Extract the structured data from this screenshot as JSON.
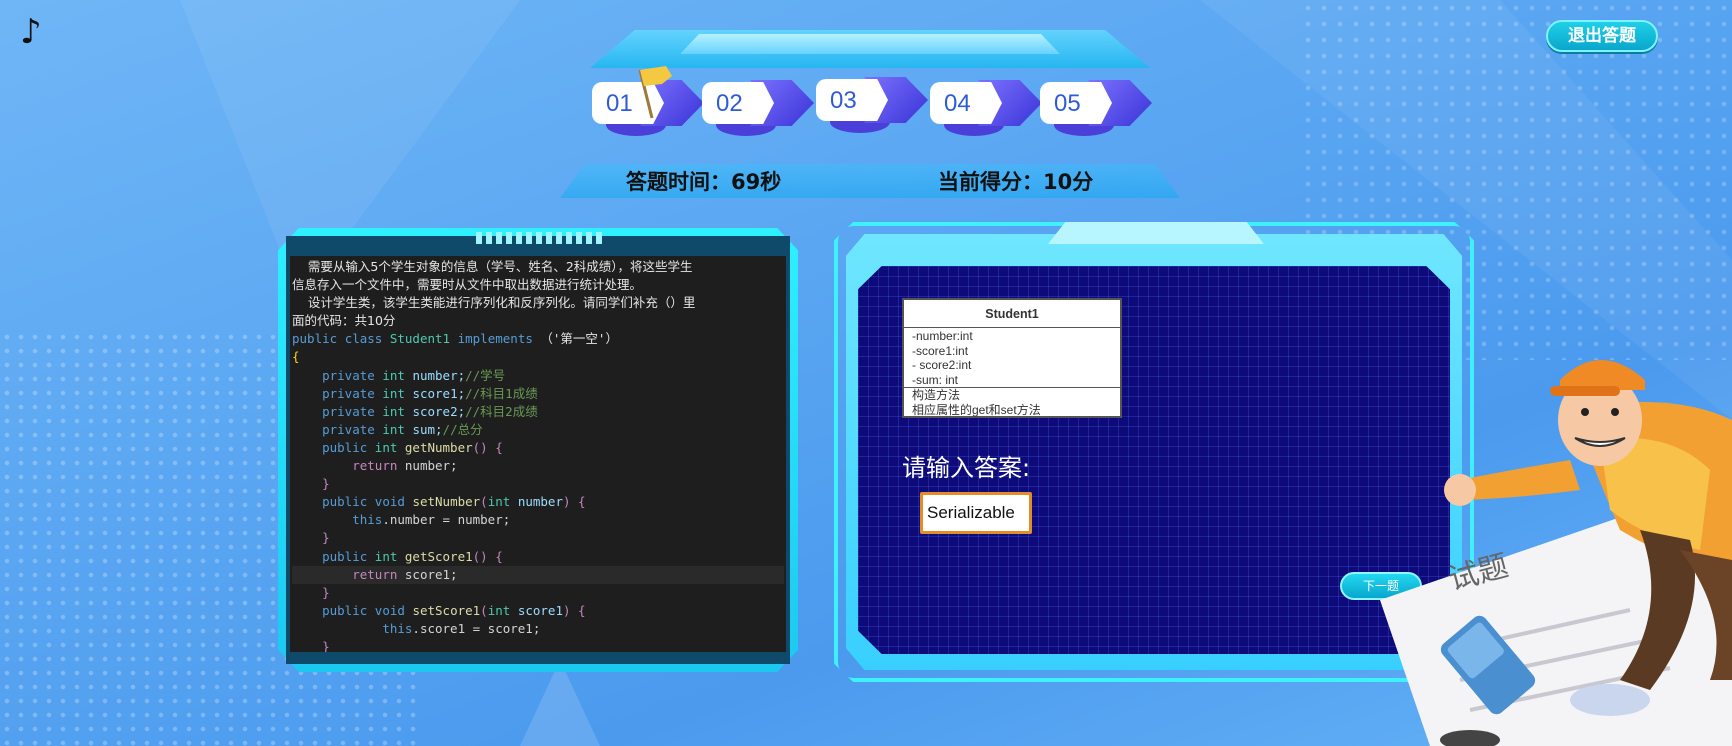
{
  "header": {
    "quit_label": "退出答题",
    "steps": [
      "01",
      "02",
      "03",
      "04",
      "05"
    ],
    "current_step": "01",
    "time_label": "答题时间：69秒",
    "score_label": "当前得分：10分"
  },
  "question": {
    "desc_lines": [
      "    需要从输入5个学生对象的信息（学号、姓名、2科成绩），将这些学生",
      "信息存入一个文件中，需要时从文件中取出数据进行统计处理。",
      "    设计学生类，该学生类能进行序列化和反序列化。请同学们补充（）里",
      "面的代码：共10分"
    ],
    "code": {
      "class_decl": [
        "public",
        "class",
        "Student1",
        "implements",
        "（'第一空'）"
      ],
      "open_brace": "{",
      "field_number": [
        "private",
        "int",
        "number;",
        "//学号"
      ],
      "field_score1": [
        "private",
        "int",
        "score1;",
        "//科目1成绩"
      ],
      "field_score2": [
        "private",
        "int",
        "score2;",
        "//科目2成绩"
      ],
      "field_sum": [
        "private",
        "int",
        "sum;",
        "//总分"
      ],
      "get_number": [
        "public",
        "int",
        "getNumber",
        "() {"
      ],
      "return_number": [
        "return",
        "number;"
      ],
      "close_brace": "}",
      "set_number": [
        "public",
        "void",
        "setNumber",
        "(",
        "int",
        "number",
        ") {"
      ],
      "assign_number": [
        "this",
        ".number = number;"
      ],
      "get_score1": [
        "public",
        "int",
        "getScore1",
        "() {"
      ],
      "return_score1": [
        "return",
        "score1;"
      ],
      "set_score1": [
        "public",
        "void",
        "setScore1",
        "(",
        "int",
        "score1",
        ") {"
      ],
      "assign_score1": [
        "this",
        ".score1 = score1;"
      ]
    }
  },
  "uml": {
    "title": "Student1",
    "fields": [
      "-number:int",
      "-score1:int",
      "- score2:int",
      "-sum:  int"
    ],
    "methods": [
      "构造方法",
      "相应属性的get和set方法"
    ]
  },
  "answer": {
    "prompt": "请输入答案:",
    "value": "Serializable",
    "next_label": "下一题"
  },
  "decoration": {
    "paper_text": "试题"
  }
}
